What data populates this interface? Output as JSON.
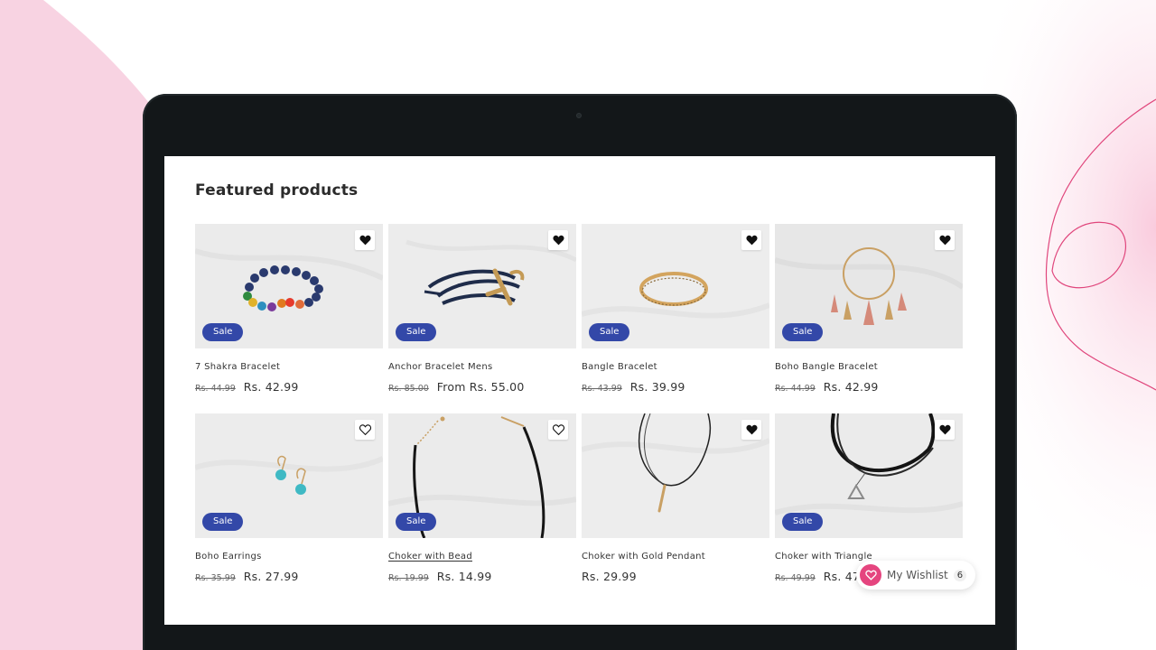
{
  "section": {
    "title": "Featured products"
  },
  "products": [
    {
      "name": "7 Shakra Bracelet",
      "old_price": "Rs. 44.99",
      "price": "Rs. 42.99",
      "sale": "Sale",
      "wishlisted": true
    },
    {
      "name": "Anchor Bracelet Mens",
      "old_price": "Rs. 85.00",
      "price": "From Rs. 55.00",
      "sale": "Sale",
      "wishlisted": true
    },
    {
      "name": "Bangle Bracelet",
      "old_price": "Rs. 43.99",
      "price": "Rs. 39.99",
      "sale": "Sale",
      "wishlisted": true
    },
    {
      "name": "Boho Bangle Bracelet",
      "old_price": "Rs. 44.99",
      "price": "Rs. 42.99",
      "sale": "Sale",
      "wishlisted": true
    },
    {
      "name": "Boho Earrings",
      "old_price": "Rs. 35.99",
      "price": "Rs. 27.99",
      "sale": "Sale",
      "wishlisted": false
    },
    {
      "name": "Choker with Bead",
      "old_price": "Rs. 19.99",
      "price": "Rs. 14.99",
      "sale": "Sale",
      "wishlisted": false
    },
    {
      "name": "Choker with Gold Pendant",
      "old_price": "",
      "price": "Rs. 29.99",
      "sale": "",
      "wishlisted": true
    },
    {
      "name": "Choker with Triangle",
      "old_price": "Rs. 49.99",
      "price": "Rs. 47",
      "sale": "Sale",
      "wishlisted": true
    }
  ],
  "wishlist": {
    "label": "My Wishlist",
    "count": "6",
    "icon": "heart-icon"
  },
  "colors": {
    "sale_badge": "#3348a8",
    "wishlist_accent": "#e5457f",
    "tablet_frame": "#131719",
    "background_pink": "#f8d3e2"
  }
}
